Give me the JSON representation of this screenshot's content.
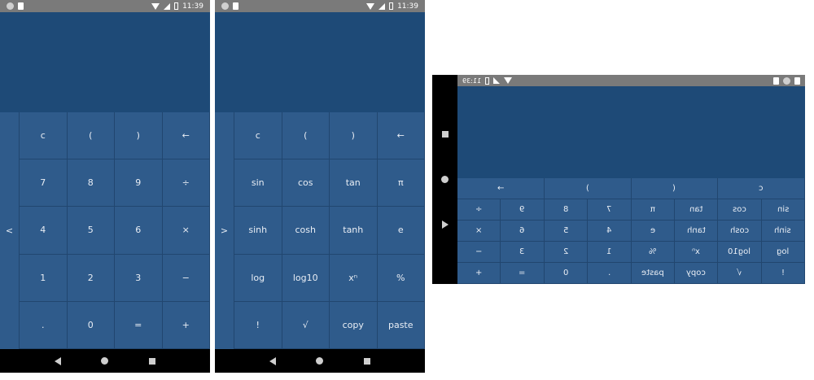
{
  "status": {
    "time": "11:39"
  },
  "phone1": {
    "drawer_glyph": "<",
    "keys": [
      "c",
      "(",
      ")",
      "←",
      "7",
      "8",
      "9",
      "÷",
      "4",
      "5",
      "6",
      "×",
      "1",
      "2",
      "3",
      "−",
      ".",
      "0",
      "=",
      "+"
    ]
  },
  "phone2": {
    "drawer_glyph": ">",
    "keys": [
      "c",
      "(",
      ")",
      "←",
      "sin",
      "cos",
      "tan",
      "π",
      "sinh",
      "cosh",
      "tanh",
      "e",
      "log",
      "log10",
      "xⁿ",
      "%",
      "!",
      "√",
      "copy",
      "paste"
    ]
  },
  "landscape": {
    "time": "11:39",
    "top_row": [
      "→",
      ")",
      "(",
      "c"
    ],
    "rows": [
      [
        "÷",
        "9",
        "8",
        "7",
        "π",
        "tan",
        "cos",
        "sin"
      ],
      [
        "×",
        "6",
        "5",
        "4",
        "e",
        "tanh",
        "cosh",
        "sinh"
      ],
      [
        "−",
        "3",
        "2",
        "1",
        "%",
        "xⁿ",
        "log10",
        "log"
      ],
      [
        "+",
        "=",
        "0",
        ".",
        "paste",
        "copy",
        "√",
        "!"
      ]
    ]
  }
}
